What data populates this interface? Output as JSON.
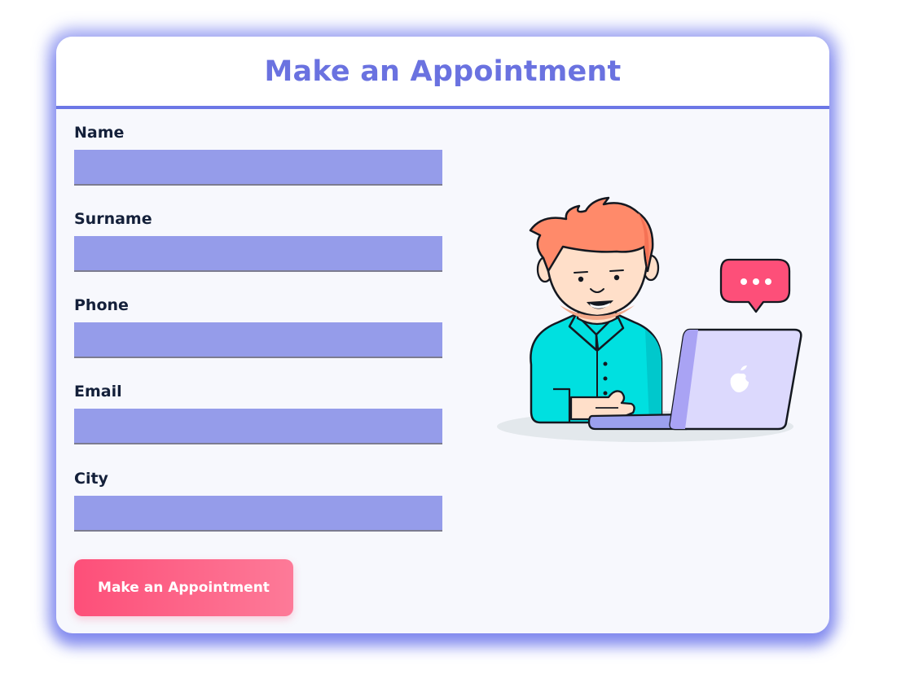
{
  "page": {
    "title": "Make an Appointment"
  },
  "form": {
    "fields": [
      {
        "label": "Name",
        "value": "",
        "placeholder": ""
      },
      {
        "label": "Surname",
        "value": "",
        "placeholder": ""
      },
      {
        "label": "Phone",
        "value": "",
        "placeholder": ""
      },
      {
        "label": "Email",
        "value": "",
        "placeholder": ""
      },
      {
        "label": "City",
        "value": "",
        "placeholder": ""
      }
    ],
    "submit_label": "Make an Appointment"
  },
  "illustration": {
    "icons": [
      "person-with-laptop-icon",
      "chat-bubble-icon",
      "apple-logo-icon"
    ]
  },
  "colors": {
    "accent": "#6a72e0",
    "input_fill": "#959cea",
    "button_start": "#fd4f79",
    "button_end": "#fd7a98",
    "card_glow": "#5d68ea"
  }
}
